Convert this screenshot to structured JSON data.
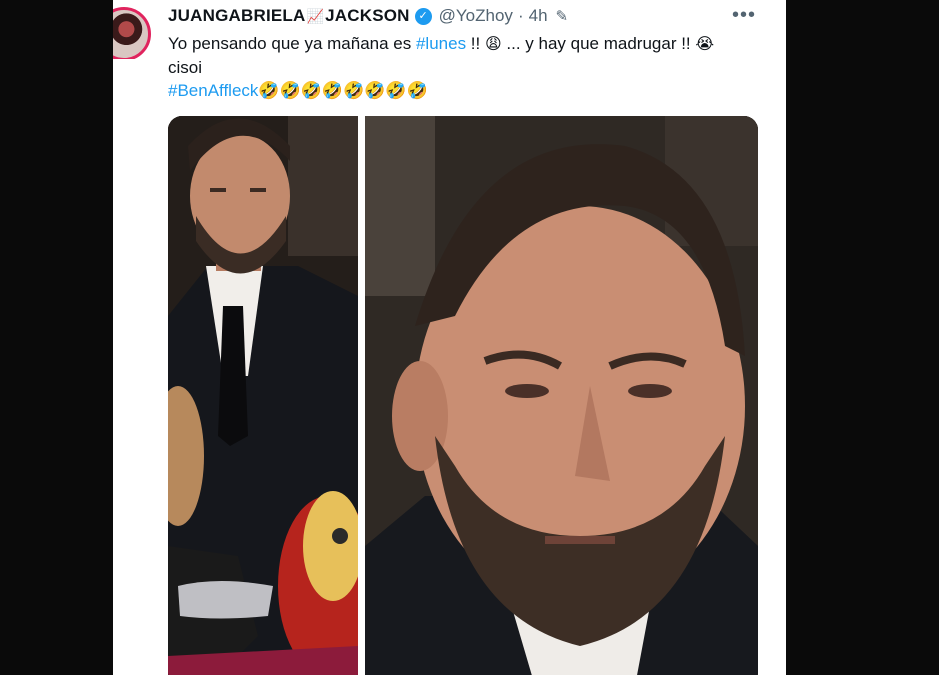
{
  "tweet": {
    "author_name": "JUANGABRIELA",
    "author_name_suffix": "JACKSON",
    "handle": "@YoZhoy",
    "separator": "·",
    "time": "4h",
    "more_label": "•••",
    "text": {
      "part1": "Yo pensando que ya mañana es ",
      "hashtag1": "#lunes",
      "part2": " !! ",
      "emoji1": "😩",
      "part3": " ... y hay que madrugar !! ",
      "emoji2": "😭",
      "line2": "cisoi",
      "hashtag2": "#BenAffleck",
      "laugh_emojis": "🤣🤣🤣🤣🤣🤣🤣🤣"
    }
  },
  "colors": {
    "hashtag": "#1d9bf0",
    "verified": "#1d9bf0",
    "secondary_text": "#536471",
    "avatar_ring": "#e0245e"
  },
  "icons": {
    "verified": "verified-badge-icon",
    "edit": "edit-pencil-icon",
    "more": "more-options-icon",
    "name_emoji": "chart-emoji-icon"
  }
}
